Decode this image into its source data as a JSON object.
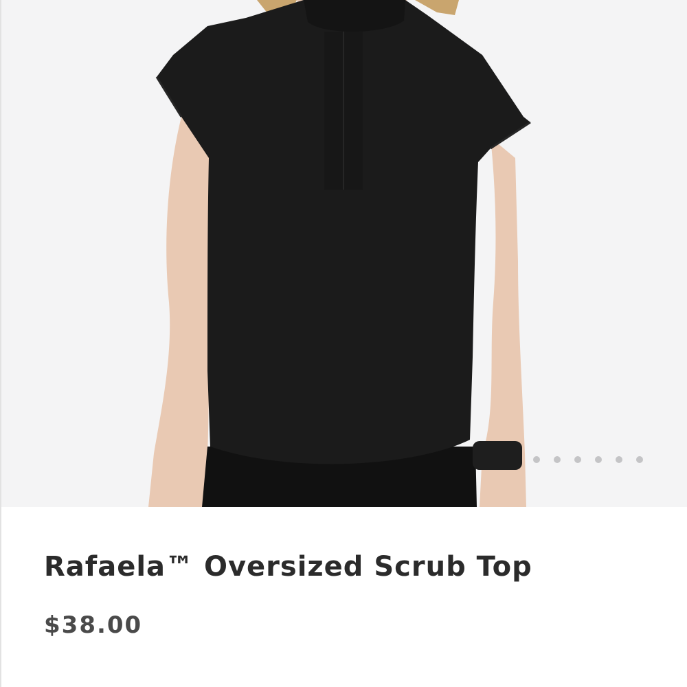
{
  "product": {
    "name": "Rafaela™ Oversized Scrub Top",
    "price": "$38.00",
    "image_alt": "black-scrub-top-photo"
  },
  "gallery": {
    "dot_count": 6,
    "dot_color": "#c4c4c6"
  },
  "colors": {
    "garment": "#1b1b1b",
    "skin": "#e9c9b3",
    "hair": "#c9a56e",
    "background": "#f4f4f5"
  }
}
